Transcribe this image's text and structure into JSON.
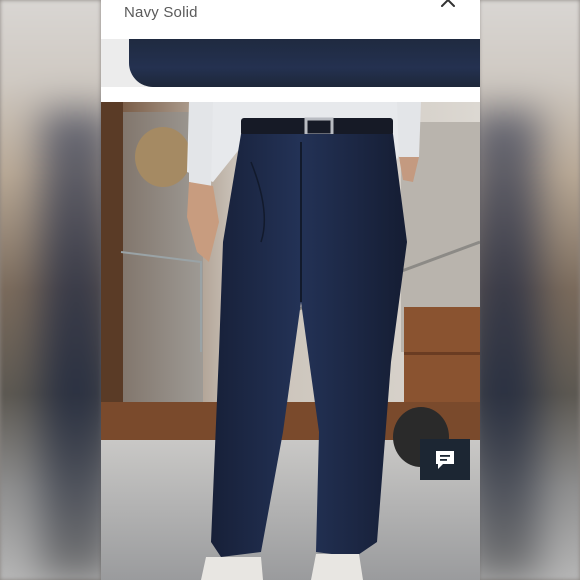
{
  "product": {
    "variant_label": "Navy Solid"
  },
  "icons": {
    "close": "close-icon",
    "chat": "chat-bubble-icon"
  },
  "colors": {
    "pants_navy": "#1e2a48",
    "chat_button": "#1c2633",
    "label_gray": "#5a5a5a"
  }
}
